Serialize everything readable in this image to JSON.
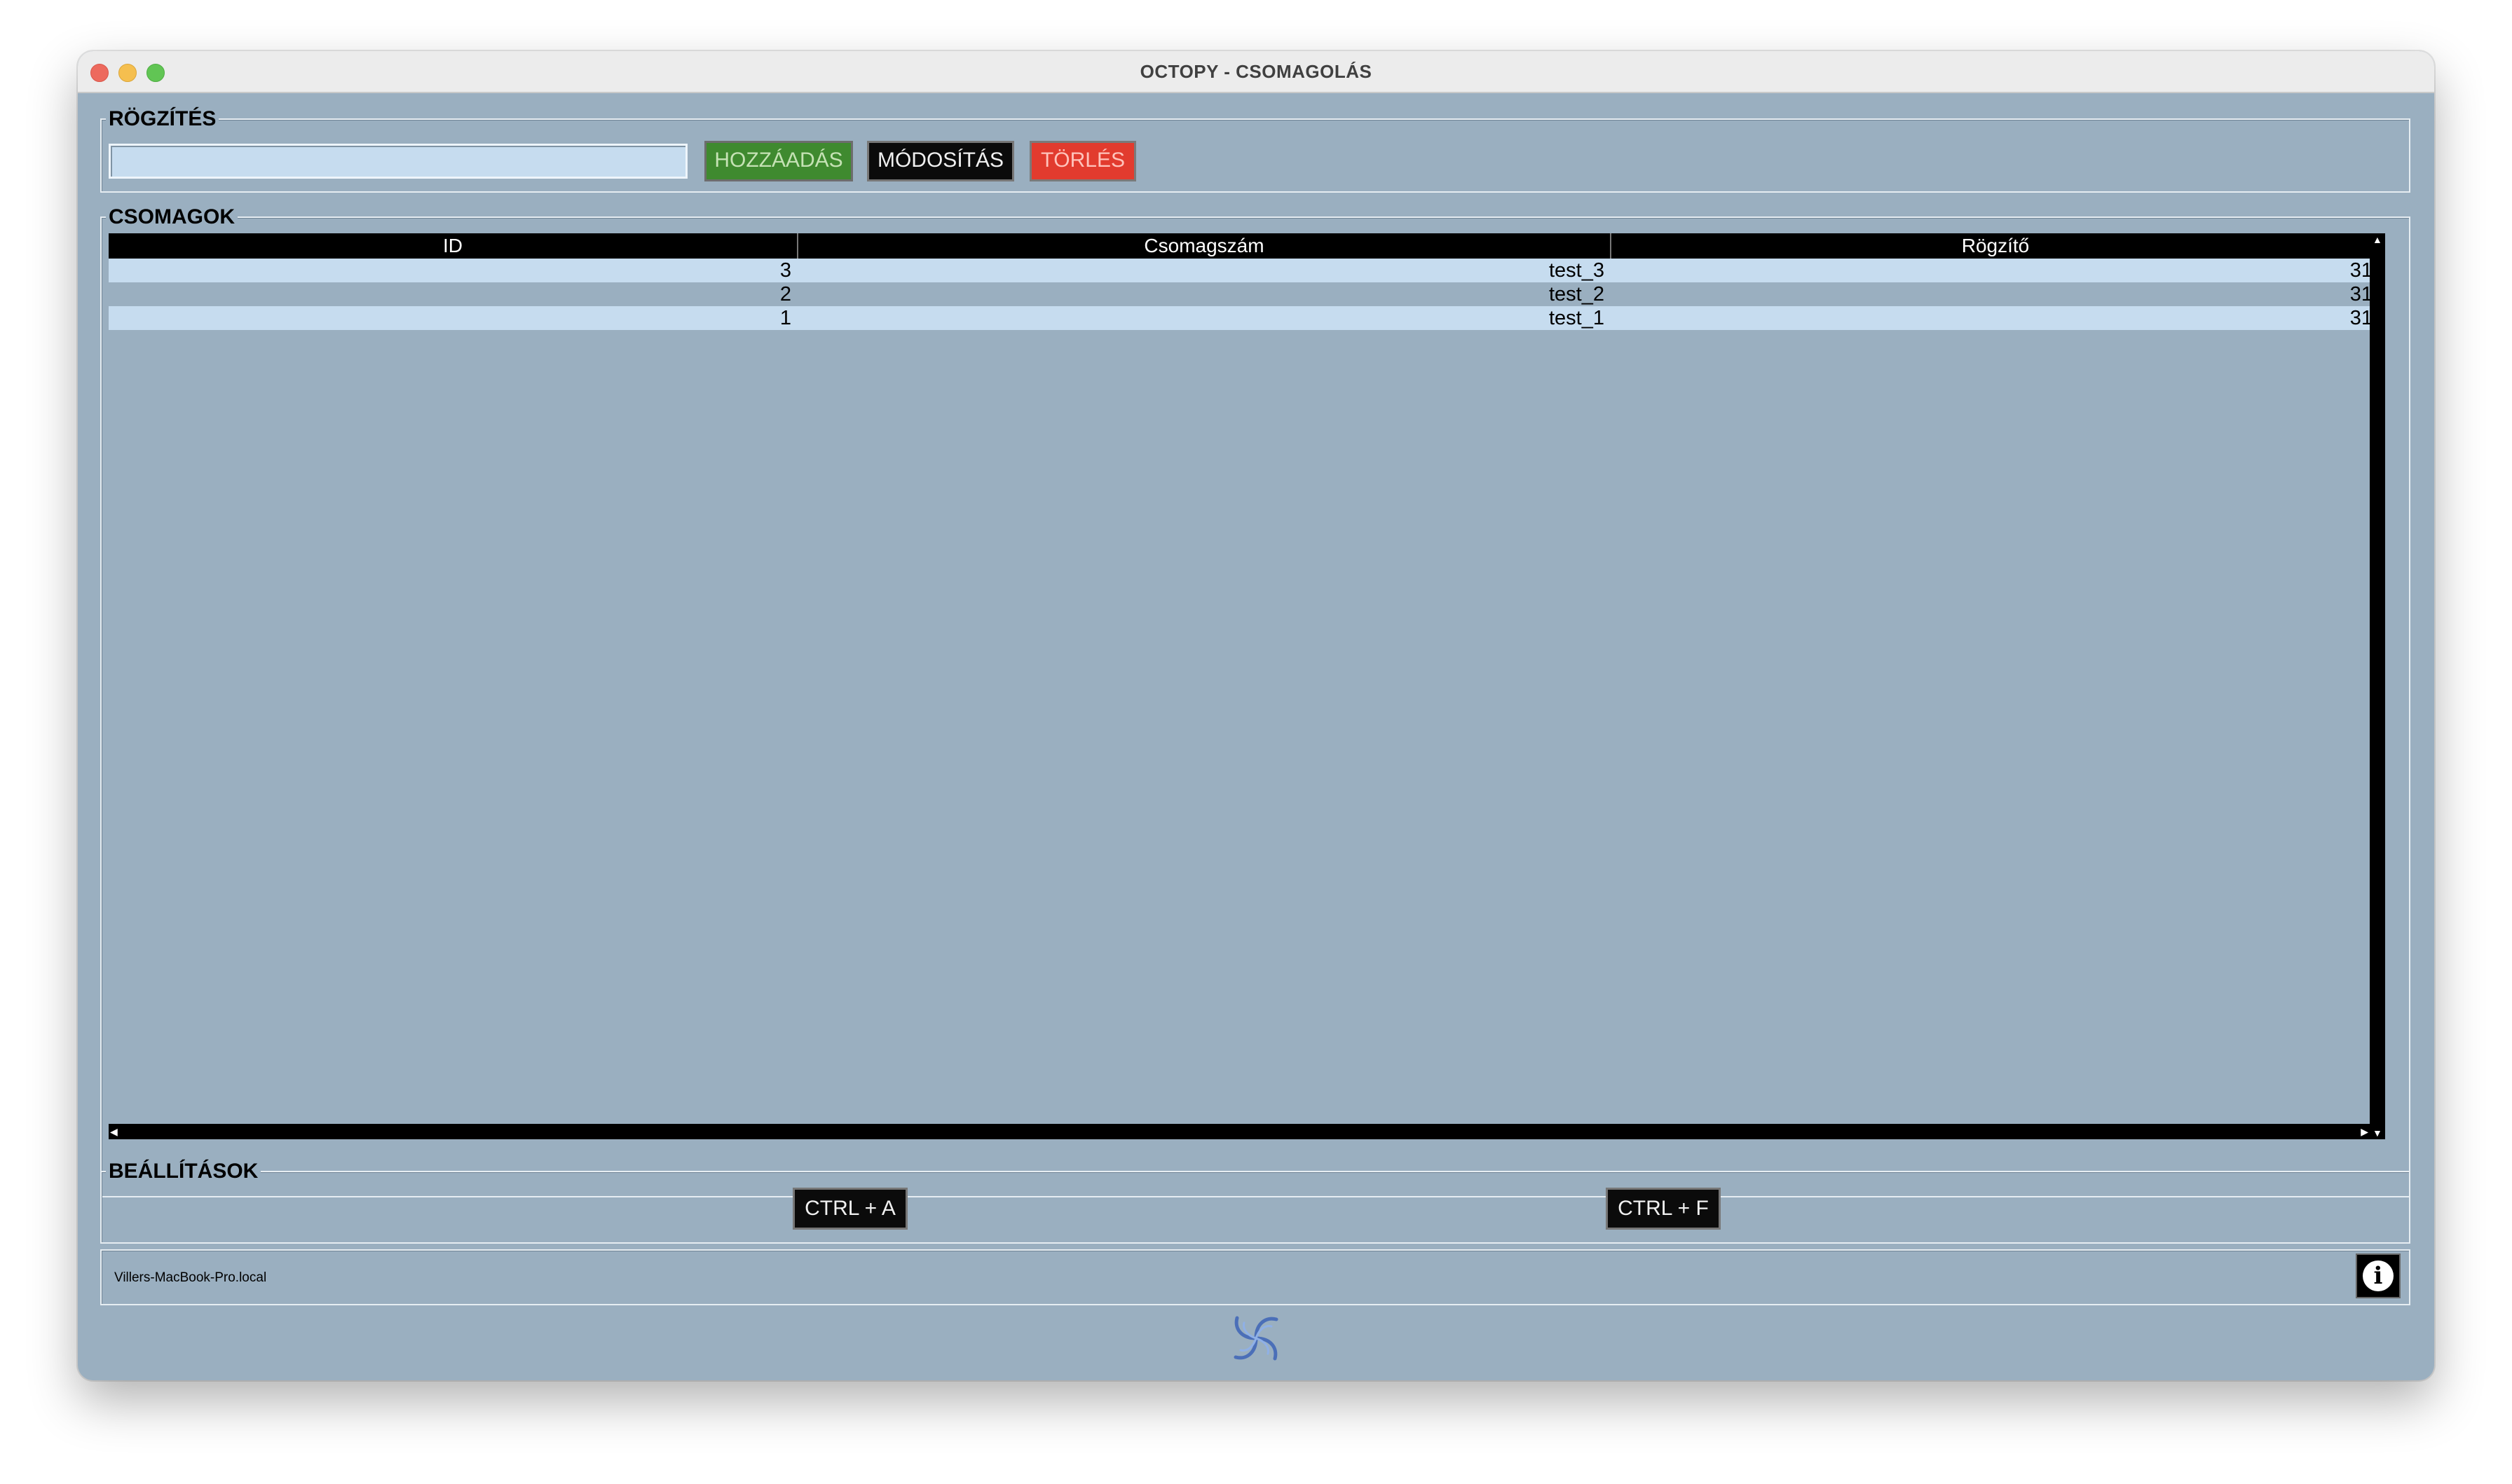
{
  "window": {
    "title": "OCTOPY - CSOMAGOLÁS"
  },
  "rogzites": {
    "label": "RÖGZÍTÉS",
    "input_value": "",
    "add_label": "HOZZÁADÁS",
    "modify_label": "MÓDOSÍTÁS",
    "delete_label": "TÖRLÉS"
  },
  "csomagok": {
    "label": "CSOMAGOK",
    "columns": [
      "ID",
      "Csomagszám",
      "Rögzítő"
    ],
    "rows": [
      {
        "id": "3",
        "csomagszam": "test_3",
        "rogzito": "31"
      },
      {
        "id": "2",
        "csomagszam": "test_2",
        "rogzito": "31"
      },
      {
        "id": "1",
        "csomagszam": "test_1",
        "rogzito": "31"
      }
    ],
    "row_colors": [
      "#c6dcef",
      "#9aafc0",
      "#c6dcef"
    ]
  },
  "beallitasok": {
    "label": "BEÁLLÍTÁSOK",
    "ctrl_a_label": "CTRL + A",
    "ctrl_f_label": "CTRL + F"
  },
  "status": {
    "hostname": "Villers-MacBook-Pro.local"
  },
  "icons": {
    "info": "info-icon",
    "logo": "octopy-swirl-logo"
  },
  "colors": {
    "window_bg": "#9aafc0",
    "row_light": "#c6dcef",
    "add_button": "#3f8a2f",
    "delete_button": "#e23b2e",
    "dark_button": "#0b0b0b"
  }
}
